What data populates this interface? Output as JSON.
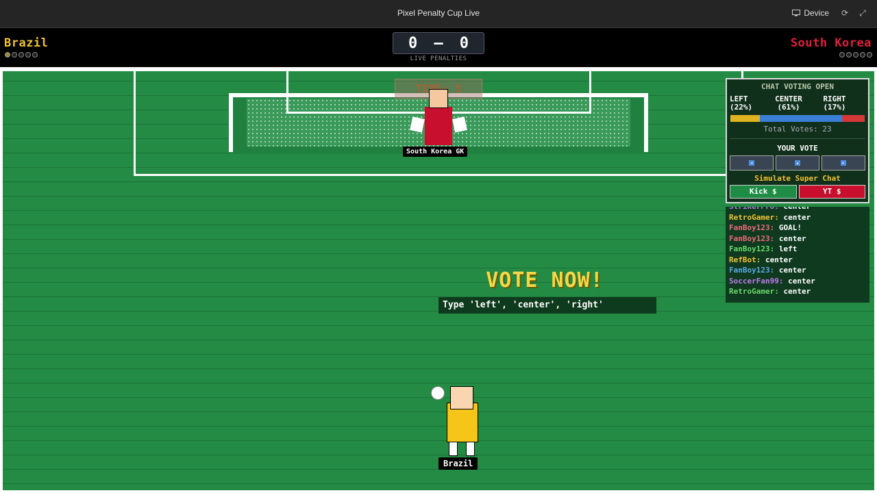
{
  "window": {
    "title": "Pixel Penalty Cup Live",
    "device_label": "Device"
  },
  "scoreboard": {
    "home_team": "Brazil",
    "away_team": "South Korea",
    "home_score": "0",
    "separator": "—",
    "away_score": "0",
    "subtitle": "LIVE PENALTIES",
    "home_attempts": [
      true,
      false,
      false,
      false,
      false
    ],
    "away_attempts": [
      false,
      false,
      false,
      false,
      false
    ],
    "home_color": "#f2c230",
    "away_color": "#e01e3c"
  },
  "pitch": {
    "timer_text": "TIME: 3",
    "goalkeeper_label": "South Korea GK",
    "kicker_label": "Brazil",
    "vote_title": "VOTE NOW!",
    "vote_hint": "Type 'left', 'center', 'right'"
  },
  "voting_panel": {
    "header": "CHAT VOTING OPEN",
    "options": [
      {
        "label": "LEFT",
        "percent": "(22%)",
        "share": 0.22,
        "color": "#e0b320"
      },
      {
        "label": "CENTER",
        "percent": "(61%)",
        "share": 0.61,
        "color": "#3a7fd5"
      },
      {
        "label": "RIGHT",
        "percent": "(17%)",
        "share": 0.17,
        "color": "#d6383a"
      }
    ],
    "total_votes": "Total Votes: 23",
    "your_vote_label": "YOUR VOTE",
    "vote_buttons": [
      "left-arrow-icon",
      "up-arrow-icon",
      "right-arrow-icon"
    ],
    "super_chat_label": "Simulate Super Chat",
    "kick_button": "Kick $",
    "yt_button": "YT $"
  },
  "chat": [
    {
      "user": "StrikerPro:",
      "msg": "center",
      "color": "#b07ae0"
    },
    {
      "user": "RetroGamer:",
      "msg": "center",
      "color": "#f2c230"
    },
    {
      "user": "FanBoy123:",
      "msg": "GOAL!",
      "color": "#f06a7a"
    },
    {
      "user": "FanBoy123:",
      "msg": "center",
      "color": "#f06a7a"
    },
    {
      "user": "FanBoy123:",
      "msg": "left",
      "color": "#6ad96a"
    },
    {
      "user": "RefBot:",
      "msg": "center",
      "color": "#f2c230"
    },
    {
      "user": "FanBoy123:",
      "msg": "center",
      "color": "#5aa9e6"
    },
    {
      "user": "SoccerFan99:",
      "msg": "center",
      "color": "#c07af0"
    },
    {
      "user": "RetroGamer:",
      "msg": "center",
      "color": "#6ad96a"
    }
  ]
}
